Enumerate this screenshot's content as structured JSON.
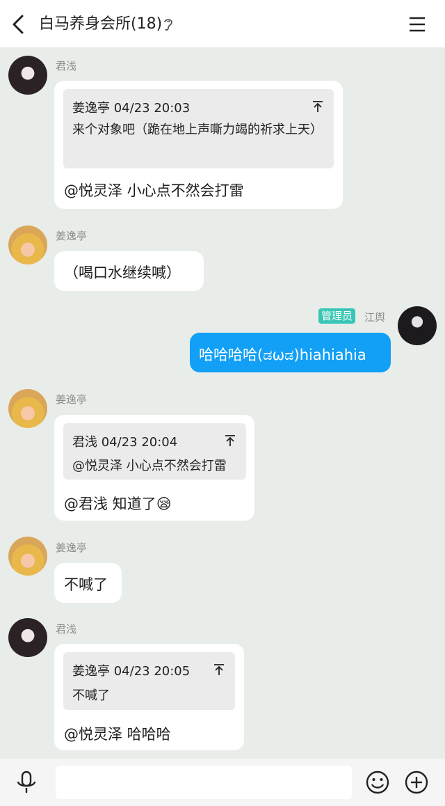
{
  "header": {
    "title": "白马养身会所(18)"
  },
  "messages": [
    {
      "sender": "君浅",
      "quote": {
        "author_time": "姜逸亭 04/23 20:03",
        "text": "来个对象吧（跪在地上声嘶力竭的祈求上天）"
      },
      "text": "@悦灵泽 小心点不然会打雷"
    },
    {
      "sender": "姜逸亭",
      "text": "（喝口水继续喊）"
    },
    {
      "sender": "江舆",
      "badge": "管理员",
      "text": "哈哈哈哈(ಡωಡ)hiahiahia"
    },
    {
      "sender": "姜逸亭",
      "quote": {
        "author_time": "君浅 04/23 20:04",
        "text": "@悦灵泽 小心点不然会打雷"
      },
      "text": "@君浅 知道了",
      "emoji": "😪"
    },
    {
      "sender": "姜逸亭",
      "text": "不喊了"
    },
    {
      "sender": "君浅",
      "quote": {
        "author_time": "姜逸亭 04/23 20:05",
        "text": "不喊了"
      },
      "text": "@悦灵泽 哈哈哈"
    }
  ],
  "input": {
    "value": ""
  },
  "colors": {
    "accent": "#12a0f7",
    "badge": "#3ac6b5",
    "background": "#e9ede9"
  },
  "icons": [
    "back-arrow-icon",
    "ear-icon",
    "menu-icon",
    "pin-top-icon",
    "microphone-icon",
    "smiley-icon",
    "plus-icon"
  ]
}
